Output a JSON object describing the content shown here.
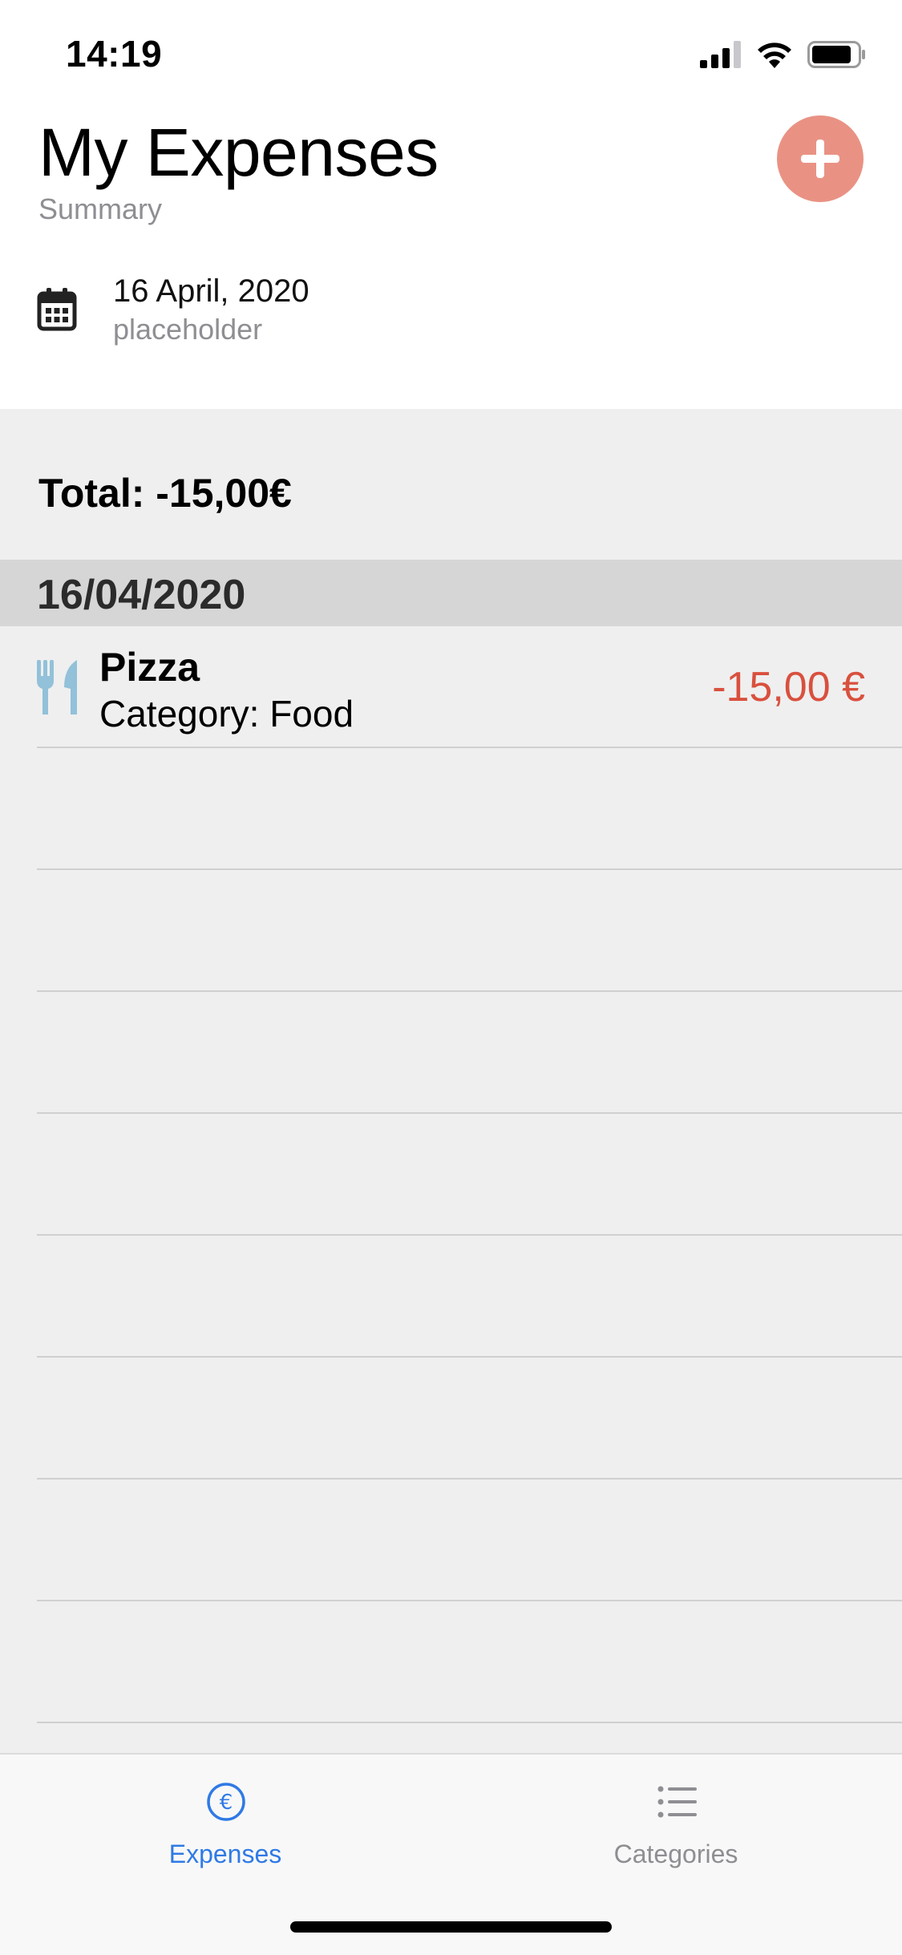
{
  "status_bar": {
    "time": "14:19"
  },
  "header": {
    "title": "My Expenses",
    "subtitle": "Summary",
    "add_button_icon": "plus-icon",
    "accent_color": "#e99284"
  },
  "date_picker": {
    "icon": "calendar-icon",
    "date": "16 April, 2020",
    "placeholder": "placeholder"
  },
  "summary": {
    "total": "Total: -15,00€"
  },
  "list": {
    "sections": [
      {
        "header": "16/04/2020",
        "items": [
          {
            "icon": "fork-knife-icon",
            "name": "Pizza",
            "category": "Category: Food",
            "amount": "-15,00 €",
            "amount_color": "#d9503e"
          }
        ]
      }
    ]
  },
  "tab_bar": {
    "tabs": [
      {
        "label": "Expenses",
        "icon": "euro-circle-icon",
        "selected": true,
        "color": "#2f7ae5"
      },
      {
        "label": "Categories",
        "icon": "list-icon",
        "selected": false,
        "color": "#8e8e93"
      }
    ]
  }
}
